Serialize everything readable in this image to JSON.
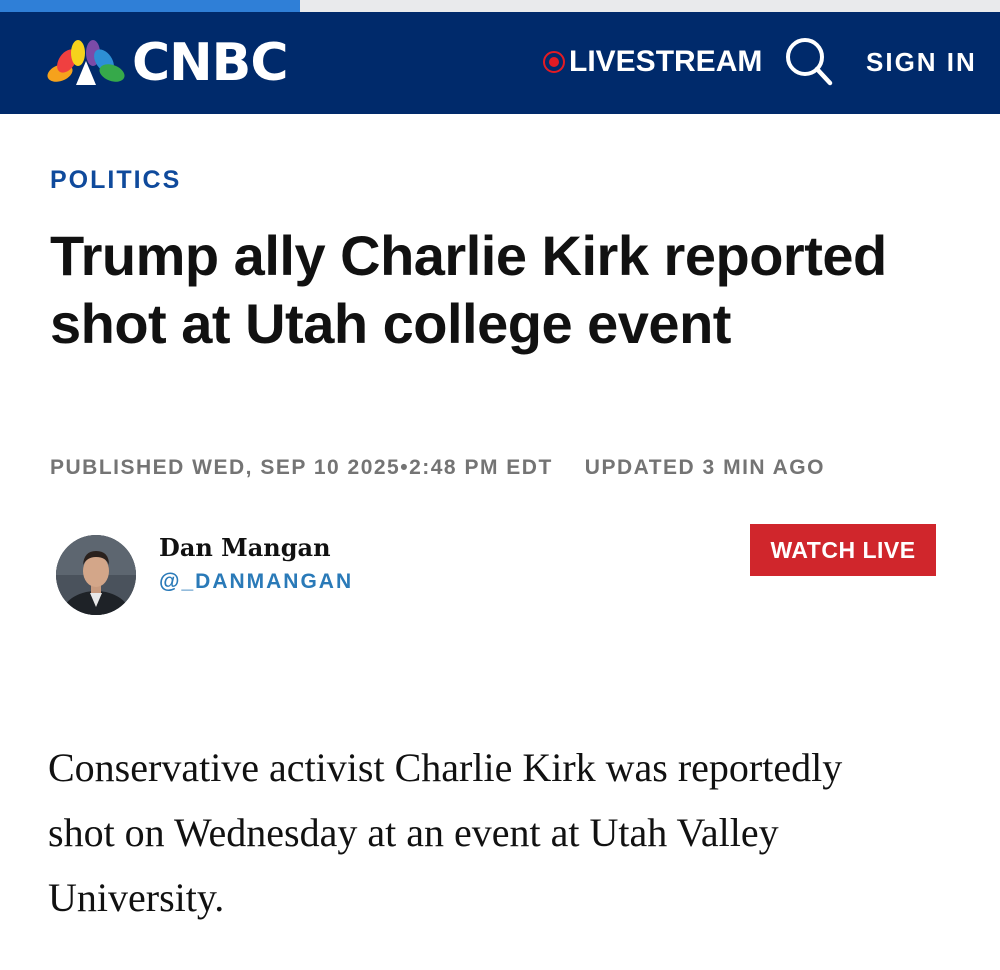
{
  "header": {
    "logo_text": "CNBC",
    "livestream_label": "LIVESTREAM",
    "search_icon": "search-icon",
    "signin_label": "SIGN IN",
    "background_color": "#002a6b"
  },
  "page_load_progress": 0.3,
  "article": {
    "category": "POLITICS",
    "headline": "Trump ally Charlie Kirk reported shot at Utah college event",
    "published": "PUBLISHED WED, SEP 10 2025•2:48 PM EDT",
    "updated": "UPDATED 3 MIN AGO",
    "author": {
      "name": "Dan Mangan",
      "handle": "@_DANMANGAN"
    },
    "watch_live_label": "WATCH LIVE",
    "body": "Conservative activist Charlie Kirk was reportedly shot on Wednesday at an event at Utah Valley University."
  },
  "colors": {
    "accent_blue": "#0f4a9c",
    "live_red": "#d0262c",
    "handle_blue": "#2a7ab8"
  }
}
